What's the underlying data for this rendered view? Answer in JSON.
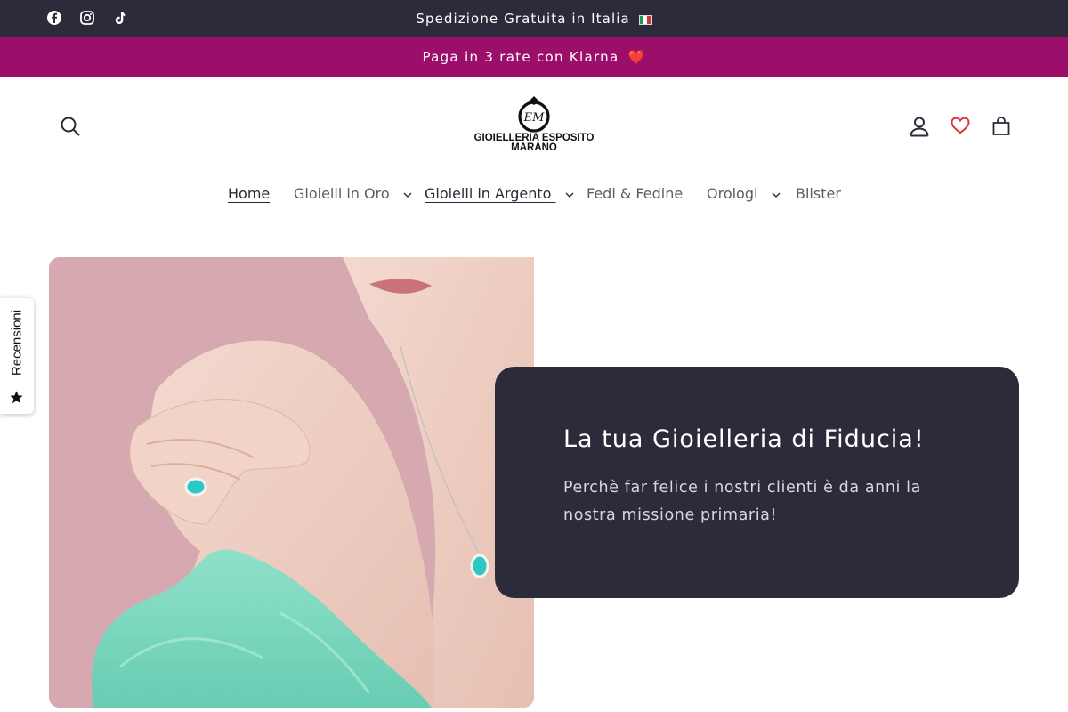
{
  "announcement": {
    "shipping_text": "Spedizione Gratuita in Italia",
    "flag_icon": "italy-flag-icon",
    "klarna_text": "Paga in 3 rate con Klarna",
    "heart_emoji": "❤️"
  },
  "social": [
    {
      "name": "facebook-icon"
    },
    {
      "name": "instagram-icon"
    },
    {
      "name": "tiktok-icon"
    }
  ],
  "header": {
    "logo_monogram": "EM",
    "logo_line1": "GIOIELLERIA ESPOSITO",
    "logo_line2": "MARANO",
    "icons": [
      "search-icon",
      "account-icon",
      "wishlist-heart-icon",
      "cart-icon"
    ]
  },
  "nav": {
    "items": [
      {
        "label": "Home",
        "active": true,
        "dropdown": false
      },
      {
        "label": "Gioielli in Oro",
        "active": false,
        "dropdown": true
      },
      {
        "label": "Gioielli in Argento",
        "active": false,
        "dropdown": true,
        "underlined": true
      },
      {
        "label": "Fedi & Fedine",
        "active": false,
        "dropdown": false
      },
      {
        "label": "Orologi",
        "active": false,
        "dropdown": true
      },
      {
        "label": "Blister",
        "active": false,
        "dropdown": false
      }
    ]
  },
  "reviews_tab": {
    "label": "Recensioni"
  },
  "hero": {
    "title": "La tua Gioielleria di Fiducia!",
    "subtitle": "Perchè far felice i nostri clienti è da anni la nostra missione primaria!"
  },
  "colors": {
    "topbar": "#2c2b3a",
    "klarna_bar": "#9b0f6b",
    "card": "#2c2b3a",
    "wishlist_heart": "#e0313f"
  }
}
